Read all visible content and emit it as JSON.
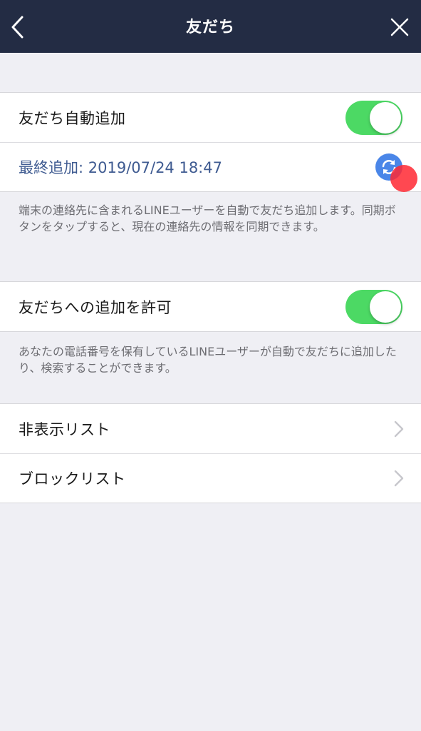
{
  "header": {
    "title": "友だち",
    "back_icon": "chevron-left-icon",
    "close_icon": "close-icon",
    "background": "#232c44"
  },
  "auto_add": {
    "label": "友だち自動追加",
    "toggle_on": true,
    "last_added": "最終追加: 2019/07/24 18:47",
    "sync_icon": "sync-icon",
    "note": "端末の連絡先に含まれるLINEユーザーを自動で友だち追加します。同期ボタンをタップすると、現在の連絡先の情報を同期できます。"
  },
  "allow_add": {
    "label": "友だちへの追加を許可",
    "toggle_on": true,
    "note": "あなたの電話番号を保有しているLINEユーザーが自動で友だちに追加したり、検索することができます。"
  },
  "lists": {
    "items": [
      {
        "label": "非表示リスト"
      },
      {
        "label": "ブロックリスト"
      }
    ],
    "chevron_icon": "chevron-right-icon"
  },
  "colors": {
    "toggle_on": "#4cd964",
    "link_text": "#3f5b91",
    "sync_button": "#4a86e8",
    "background": "#efeff4"
  }
}
